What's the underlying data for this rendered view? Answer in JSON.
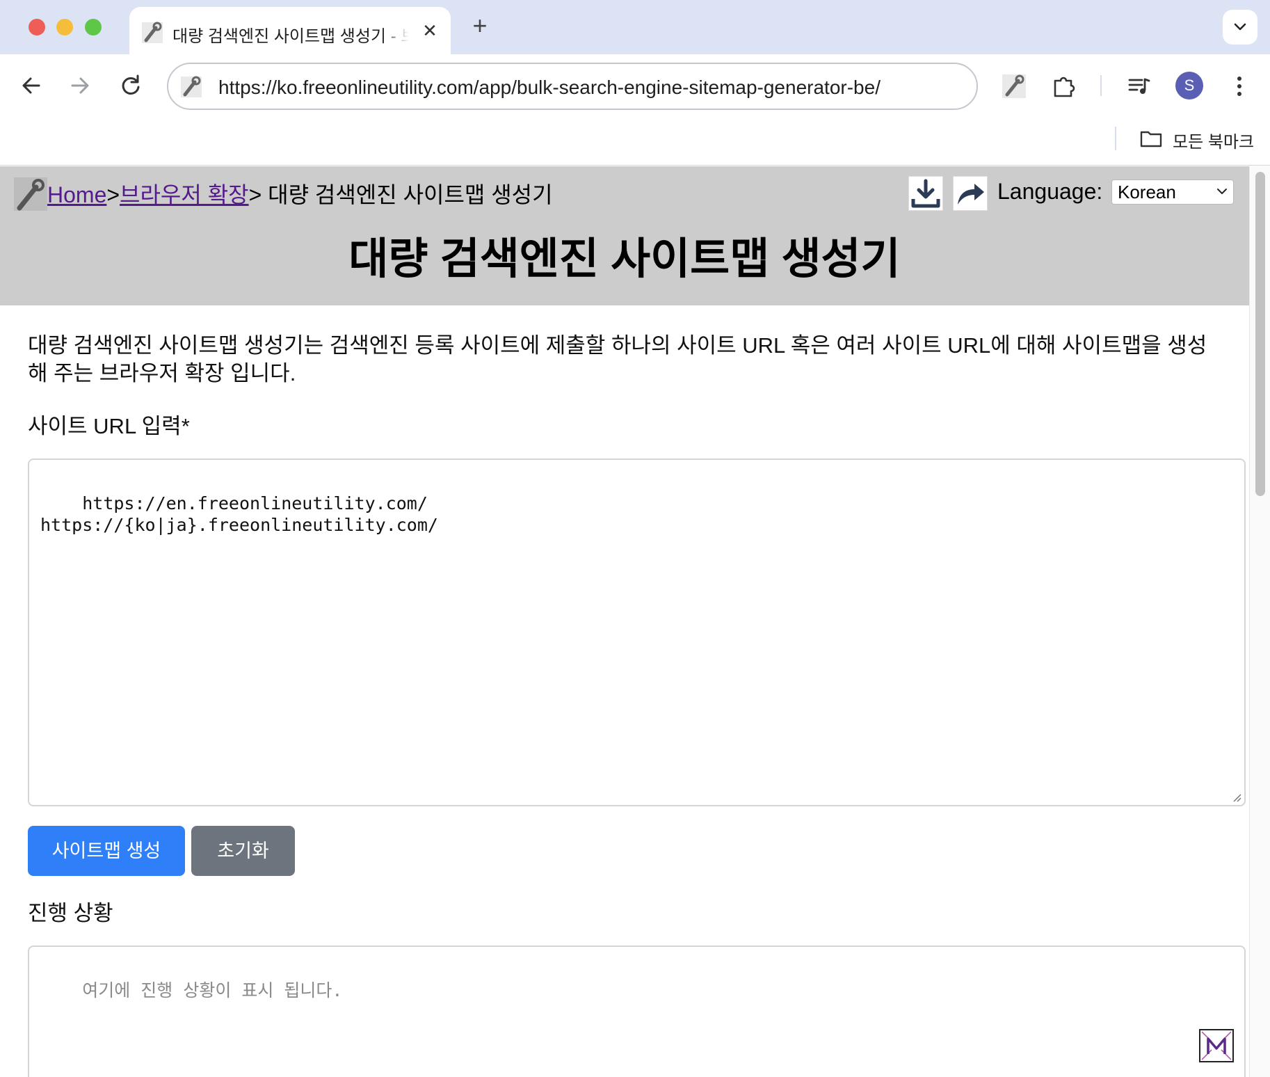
{
  "browser": {
    "tab_title": "대량 검색엔진 사이트맵 생성기 - 브라우저 확장",
    "url": "https://ko.freeonlineutility.com/app/bulk-search-engine-sitemap-generator-be/",
    "profile_initial": "S",
    "bookmarks_label": "모든 북마크"
  },
  "header": {
    "breadcrumb_home": "Home",
    "breadcrumb_sep": ">",
    "breadcrumb_category": "브라우저 확장",
    "breadcrumb_current": "> 대량 검색엔진 사이트맵 생성기",
    "language_label": "Language:",
    "language_selected": "Korean",
    "title": "대량 검색엔진 사이트맵 생성기"
  },
  "main": {
    "description": "대량 검색엔진 사이트맵 생성기는 검색엔진 등록 사이트에 제출할 하나의 사이트 URL 혹은 여러 사이트 URL에 대해 사이트맵을 생성해 주는 브라우저 확장 입니다.",
    "url_input_label": "사이트 URL 입력*",
    "url_input_value": "https://en.freeonlineutility.com/\nhttps://{ko|ja}.freeonlineutility.com/",
    "generate_button": "사이트맵 생성",
    "reset_button": "초기화",
    "progress_label": "진행 상황",
    "progress_placeholder": "여기에 진행 상황이 표시 됩니다."
  },
  "colors": {
    "header_bg": "#cccccc",
    "primary_button": "#2f7ff8",
    "secondary_button": "#6c757d",
    "link_visited": "#551a8b"
  }
}
